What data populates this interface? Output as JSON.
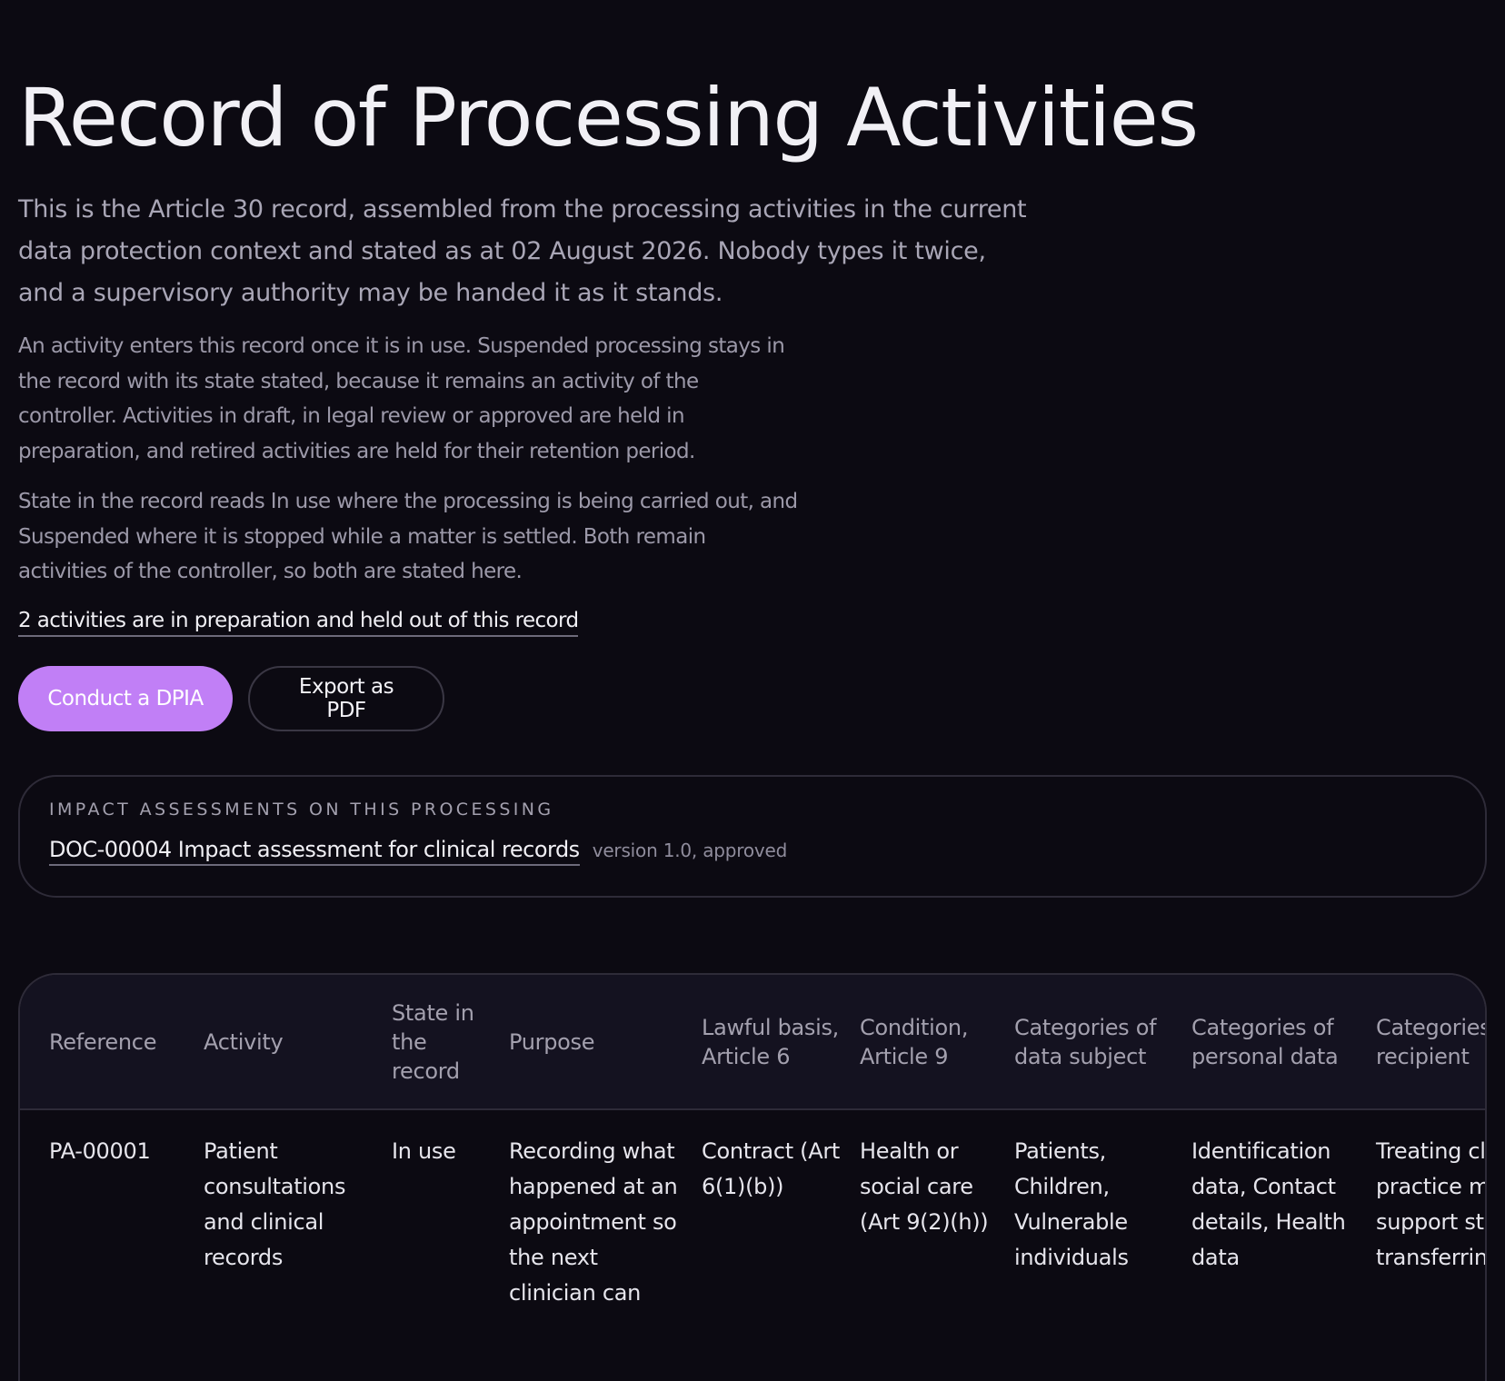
{
  "header": {
    "title": "Record of Processing Activities",
    "lede": "This is the Article 30 record, assembled from the processing activities in the current data protection context and stated as at 02 August 2026. Nobody types it twice, and a supervisory authority may be handed it as it stands."
  },
  "intro": {
    "paragraph_1": "An activity enters this record once it is in use. Suspended processing stays in the record with its state stated, because it remains an activity of the controller. Activities in draft, in legal review or approved are held in preparation, and retired activities are held for their retention period.",
    "paragraph_2": "State in the record reads In use where the processing is being carried out, and Suspended where it is stopped while a matter is settled. Both remain activities of the controller, so both are stated here.",
    "preparation_link": "2 activities are in preparation and held out of this record"
  },
  "actions": {
    "primary_label": "Conduct a DPIA",
    "secondary_label": "Export as PDF"
  },
  "impact": {
    "heading": "Impact assessments on this processing",
    "document_link": "DOC-00004 Impact assessment for clinical records",
    "document_meta": "version 1.0, approved"
  },
  "table": {
    "columns": [
      "Reference",
      "Activity",
      "State in the record",
      "Purpose",
      "Lawful basis, Article 6",
      "Condition, Article 9",
      "Categories of data subject",
      "Categories of personal data",
      "Categories of recipient"
    ],
    "rows": [
      {
        "reference": "PA-00001",
        "activity": "Patient consultations and clinical records",
        "state": "In use",
        "purpose": "Recording what happened at an appointment so the next clinician can",
        "lawful_basis": "Contract (Art 6(1)(b))",
        "condition": "Health or social care (Art 9(2)(h))",
        "data_subjects": "Patients, Children, Vulnerable individuals",
        "personal_data": "Identification data, Contact details, Health data",
        "recipients": "Treating clinicians, practice managers, support staff, the transferring"
      }
    ]
  }
}
